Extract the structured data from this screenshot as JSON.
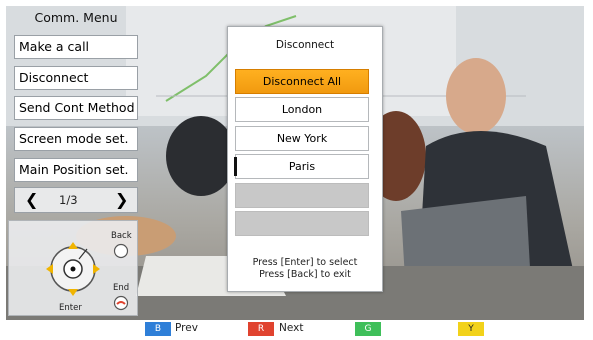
{
  "menu": {
    "title": "Comm. Menu",
    "items": [
      {
        "label": "Make a call"
      },
      {
        "label": "Disconnect"
      },
      {
        "label": "Send Cont Method"
      },
      {
        "label": "Screen mode set."
      },
      {
        "label": "Main Position set."
      }
    ],
    "page_indicator": "1/3"
  },
  "remote": {
    "back_label": "Back",
    "end_label": "End",
    "enter_label": "Enter"
  },
  "dialog": {
    "title": "Disconnect",
    "options": [
      {
        "label": "Disconnect All",
        "selected": true
      },
      {
        "label": "London"
      },
      {
        "label": "New York"
      },
      {
        "label": "Paris"
      },
      {
        "label": ""
      },
      {
        "label": ""
      }
    ],
    "hint_line1": "Press [Enter] to select",
    "hint_line2": "Press [Back] to exit"
  },
  "bottom_bar": {
    "keys": [
      {
        "key": "B",
        "label": "Prev",
        "color": "#2f7fd8"
      },
      {
        "key": "R",
        "label": "Next",
        "color": "#e0432f"
      },
      {
        "key": "G",
        "label": "",
        "color": "#3fbf5a"
      },
      {
        "key": "Y",
        "label": "",
        "color": "#f2d21a"
      }
    ]
  },
  "colors": {
    "selected_option": "#f5a10f",
    "menu_border": "#9aa0a6"
  }
}
